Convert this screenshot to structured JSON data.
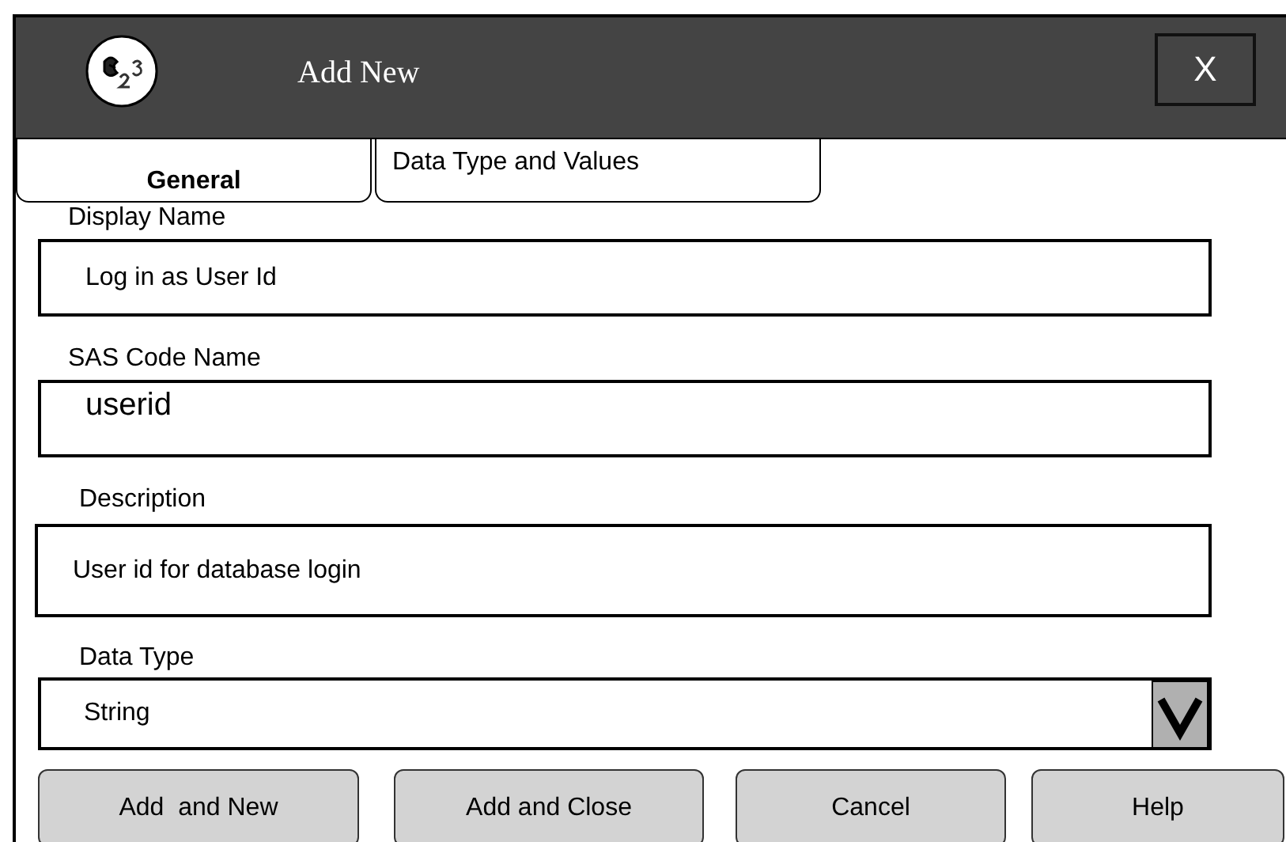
{
  "window": {
    "title": "Add New",
    "close_label": "X"
  },
  "tabs": [
    {
      "label": "General",
      "selected": true
    },
    {
      "label": "Data Type and Values",
      "selected": false
    }
  ],
  "fields": [
    {
      "kind": "text",
      "label": "Display Name",
      "value": "Log in as User Id"
    },
    {
      "kind": "code",
      "label": "SAS Code Name",
      "value": "userid"
    },
    {
      "kind": "text",
      "label": "Description",
      "value": "User id for database login"
    },
    {
      "kind": "select",
      "label": "Data Type",
      "value": "String"
    }
  ],
  "buttons": [
    "Add  and New",
    "Add and Close",
    "Cancel",
    "Help"
  ]
}
